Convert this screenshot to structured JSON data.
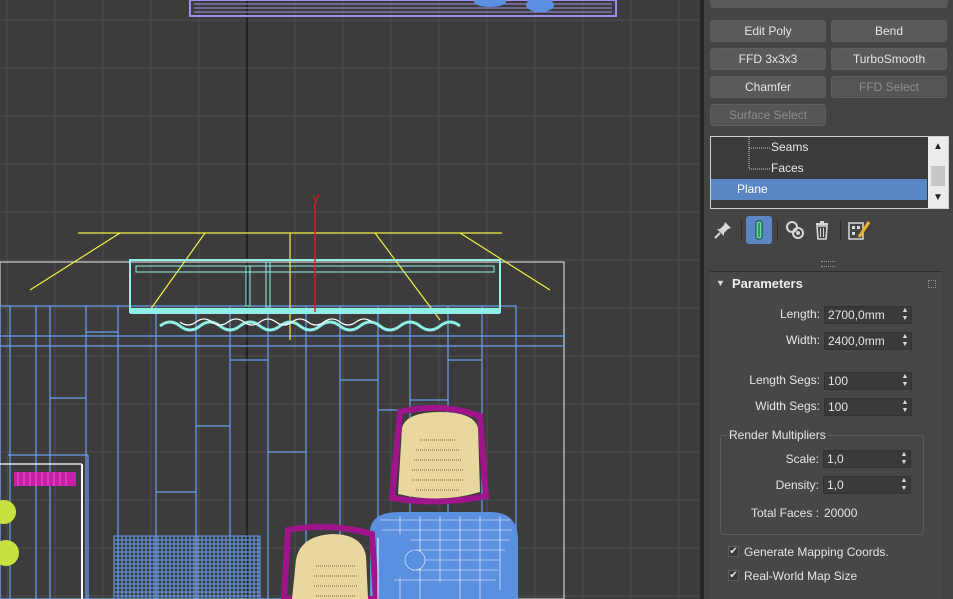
{
  "viewport": {
    "axis_label": "y",
    "colors": {
      "background": "#3c3c3c",
      "grid": "#4e4e4e",
      "blue_wire": "#6aa0f0",
      "cyan_wire": "#8ff0e8",
      "yellow_wire": "#f0f040",
      "magenta": "#a0148c",
      "chair_fill": "#e8d8a0",
      "blue_fill": "#5b8fe0"
    }
  },
  "modifier_buttons": [
    {
      "label": "Edit Poly",
      "enabled": true
    },
    {
      "label": "Bend",
      "enabled": true
    },
    {
      "label": "FFD 3x3x3",
      "enabled": true
    },
    {
      "label": "TurboSmooth",
      "enabled": true
    },
    {
      "label": "Chamfer",
      "enabled": true
    },
    {
      "label": "FFD Select",
      "enabled": false
    },
    {
      "label": "Surface Select",
      "enabled": false
    }
  ],
  "modifier_stack": {
    "items": [
      {
        "label": "Seams",
        "selected": false
      },
      {
        "label": "Faces",
        "selected": false
      },
      {
        "label": "Plane",
        "selected": true
      }
    ]
  },
  "stack_tools": [
    "pin-stack-icon",
    "show-end-result-icon",
    "make-unique-icon",
    "remove-modifier-icon",
    "configure-modifier-sets-icon"
  ],
  "parameters": {
    "title": "Parameters",
    "length_label": "Length:",
    "length_value": "2700,0mm",
    "width_label": "Width:",
    "width_value": "2400,0mm",
    "length_segs_label": "Length Segs:",
    "length_segs_value": "100",
    "width_segs_label": "Width Segs:",
    "width_segs_value": "100",
    "render_multipliers": {
      "title": "Render Multipliers",
      "scale_label": "Scale:",
      "scale_value": "1,0",
      "density_label": "Density:",
      "density_value": "1,0",
      "total_faces_label": "Total Faces :",
      "total_faces_value": "20000"
    },
    "generate_mapping_label": "Generate Mapping Coords.",
    "generate_mapping_checked": true,
    "real_world_label": "Real-World Map Size",
    "real_world_checked": true
  },
  "accent_color": "#5b86c4"
}
